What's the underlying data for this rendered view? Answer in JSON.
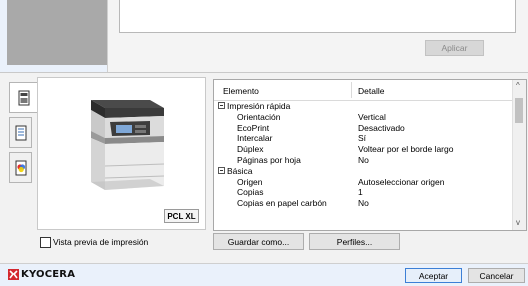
{
  "top": {
    "apply_label": "Aplicar"
  },
  "tabs": [
    {
      "name": "printer-tab-icon"
    },
    {
      "name": "document-tab-icon"
    },
    {
      "name": "color-tab-icon"
    }
  ],
  "preview": {
    "pcl_badge": "PCL XL"
  },
  "table": {
    "col_element": "Elemento",
    "col_detail": "Detalle",
    "rows": [
      {
        "group": true,
        "label": "Impresión rápida",
        "value": ""
      },
      {
        "group": false,
        "label": "Orientación",
        "value": "Vertical"
      },
      {
        "group": false,
        "label": "EcoPrint",
        "value": "Desactivado"
      },
      {
        "group": false,
        "label": "Intercalar",
        "value": "Sí"
      },
      {
        "group": false,
        "label": "Dúplex",
        "value": "Voltear por el borde largo"
      },
      {
        "group": false,
        "label": "Páginas por hoja",
        "value": "No"
      },
      {
        "group": true,
        "label": "Básica",
        "value": ""
      },
      {
        "group": false,
        "label": "Origen",
        "value": "Autoseleccionar origen"
      },
      {
        "group": false,
        "label": "Copias",
        "value": "1"
      },
      {
        "group": false,
        "label": "Copias en papel carbón",
        "value": "No"
      }
    ]
  },
  "bottom": {
    "preview_checkbox_label": "Vista previa de impresión",
    "save_as_label": "Guardar como...",
    "profiles_label": "Perfiles..."
  },
  "footer": {
    "brand": "KYOCERA",
    "accept_label": "Aceptar",
    "cancel_label": "Cancelar"
  },
  "colors": {
    "brand_red": "#d3282f",
    "primary_border": "#3c7fd6"
  }
}
